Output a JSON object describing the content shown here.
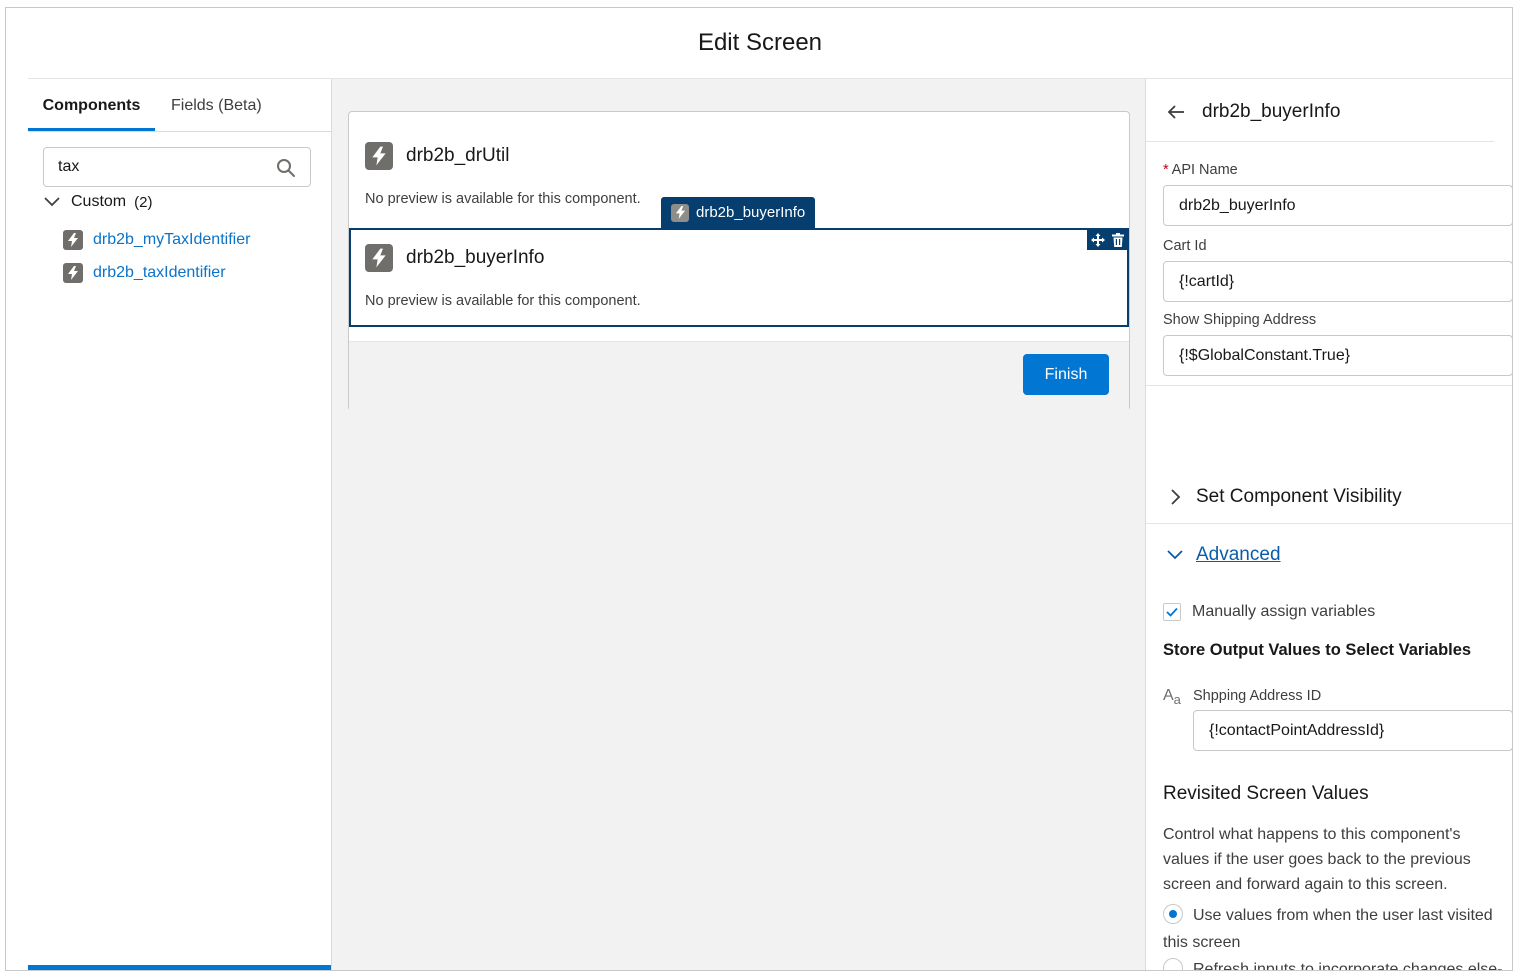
{
  "title": "Edit Screen",
  "left_panel": {
    "tabs": [
      "Components",
      "Fields (Beta)"
    ],
    "search_value": "tax",
    "group": {
      "label": "Custom",
      "count": "(2)"
    },
    "items": [
      "drb2b_myTaxIdentifier",
      "drb2b_taxIdentifier"
    ]
  },
  "canvas": {
    "components": [
      {
        "name": "drb2b_drUtil",
        "note": "No preview is available for this component."
      },
      {
        "name": "drb2b_buyerInfo",
        "note": "No preview is available for this component."
      }
    ],
    "drag_badge": "drb2b_buyerInfo",
    "finish_label": "Finish"
  },
  "properties": {
    "header": "drb2b_buyerInfo",
    "api_name_label": "API Name",
    "api_name_value": "drb2b_buyerInfo",
    "cart_id_label": "Cart Id",
    "cart_id_value": "{!cartId}",
    "show_shipping_label": "Show Shipping Address",
    "show_shipping_value": "{!$GlobalConstant.True}",
    "visibility_label": "Set Component Visibility",
    "advanced_label": "Advanced",
    "manual_assign_label": "Manually assign variables",
    "manual_assign_checked": true,
    "store_output_heading": "Store Output Values to Select Variables",
    "shipping_id_label": "Shpping Address ID",
    "shipping_id_value": "{!contactPointAddressId}",
    "revisited_heading": "Revisited Screen Values",
    "revisited_desc": "Control what happens to this component's values if the user goes back to the previous screen and forward again to this screen.",
    "radio_options": [
      {
        "label": "Use values from when the user last visited this screen",
        "selected": true
      },
      {
        "label": "Refresh inputs to incorporate changes else-",
        "selected": false
      }
    ]
  },
  "colors": {
    "brand": "#0176d3",
    "selected_border": "#053e6f",
    "link": "#0b73c8"
  }
}
